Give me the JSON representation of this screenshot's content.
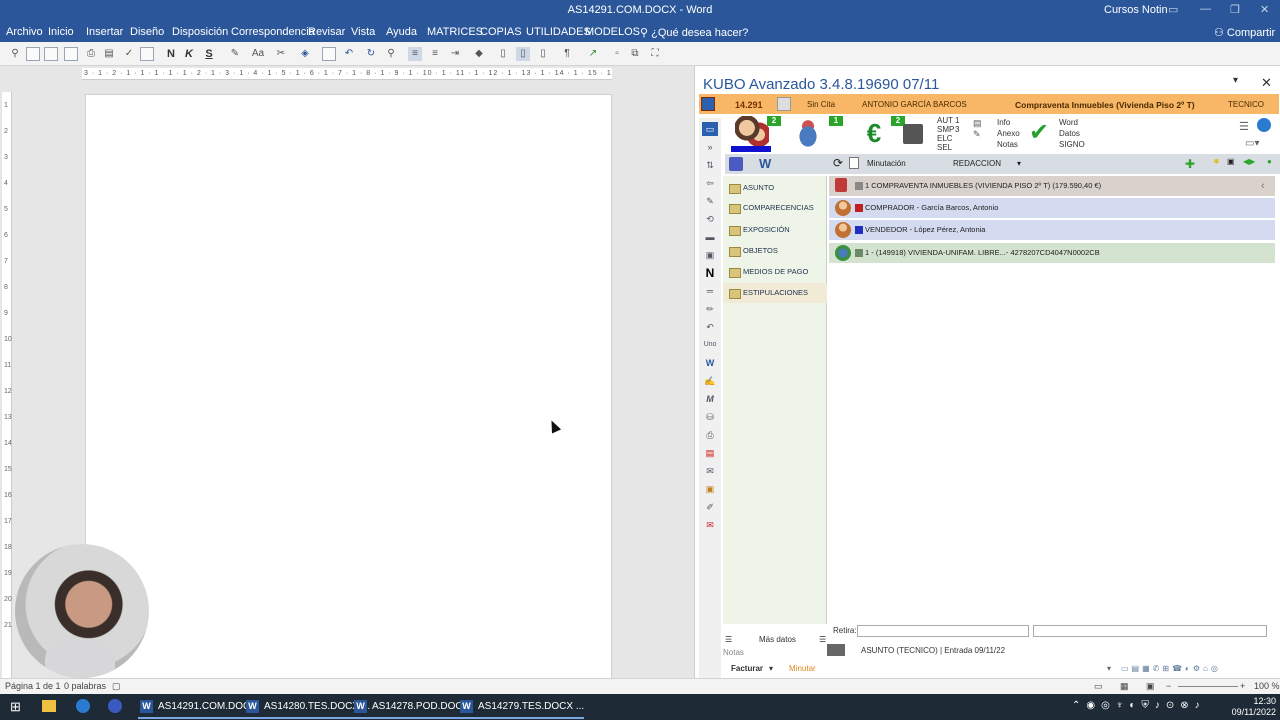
{
  "window": {
    "title": "AS14291.COM.DOCX - Word",
    "user": "Cursos Notin",
    "controls": [
      "▭",
      "—",
      "❐",
      "✕"
    ]
  },
  "menu": [
    "Archivo",
    "Inicio",
    "Insertar",
    "Diseño",
    "Disposición",
    "Correspondencia",
    "Revisar",
    "Vista",
    "Ayuda",
    "MATRICES",
    "COPIAS",
    "UTILIDADES",
    "MODELOS",
    "¿Qué desea hacer?"
  ],
  "share_label": "Compartir",
  "toolbar": {
    "bold": "N",
    "italic": "K",
    "underline": "S",
    "font_size": "Aa",
    "pilcrow": "¶"
  },
  "ruler": {
    "horizontal": "3 · 1 · 2 · 1 · 1 · 1 · 1 · 1 · 2 · 1 · 3 · 1 · 4 · 1 · 5 · 1 · 6 · 1 · 7 · 1 · 8 · 1 · 9 · 1 · 10 · 1 · 11 · 1 · 12 · 1 · 13 · 1 · 14 · 1 · 15 · 1 · 16",
    "vertical_ticks": [
      "1",
      "2",
      "3",
      "4",
      "5",
      "6",
      "7",
      "8",
      "9",
      "10",
      "11",
      "12",
      "13",
      "14",
      "15",
      "16",
      "17",
      "18",
      "19",
      "20",
      "21"
    ]
  },
  "status": {
    "page": "Página 1 de 1",
    "words": "0 palabras",
    "zoom": "100 %"
  },
  "taskbar": {
    "items": [
      "AS14291.COM.DOC...",
      "AS14280.TES.DOCX ...",
      "AS14278.POD.DOC...",
      "AS14279.TES.DOCX ..."
    ],
    "time": "12:30",
    "date": "09/11/2022"
  },
  "kubo": {
    "title": "KUBO Avanzado 3.4.8.19690   07/11",
    "bar": {
      "number": "14.291",
      "cita": "Sin Cita",
      "person": "ANTONIO GARCÍA BARCOS",
      "subject": "Compraventa Inmuebles (Vivienda Piso 2º T)",
      "role": "TECNICO"
    },
    "badges": [
      "2",
      "1",
      "2"
    ],
    "codes": [
      "AUT",
      "SMP",
      "ELC",
      "SEL"
    ],
    "code_counts": [
      "1",
      "3"
    ],
    "info_links": [
      "Info",
      "Anexo",
      "Notas"
    ],
    "word_links": [
      "Word",
      "Datos",
      "SIGNO"
    ],
    "second_row": {
      "minutacion": "Minutación",
      "redaccion": "REDACCION"
    },
    "nav": [
      "ASUNTO",
      "COMPARECENCIAS",
      "EXPOSICIÓN",
      "OBJETOS",
      "MEDIOS DE PAGO",
      "ESTIPULACIONES"
    ],
    "rows": [
      "1 COMPRAVENTA INMUEBLES (VIVIENDA PISO 2º T) (179.590,40 €)",
      "COMPRADOR - García Barcos, Antonio",
      "VENDEDOR - López Pérez, Antonia",
      "1 - (149918) VIVIENDA-UNIFAM. LIBRE...- 4278207CD4047N0002CB"
    ],
    "bottom": {
      "retira": "Retira:",
      "mas_datos": "Más datos",
      "notas": "Notas",
      "asunto_status": "ASUNTO (TECNICO)  |  Entrada 09/11/22",
      "facturar": "Facturar",
      "minutar": "Minutar"
    }
  },
  "colors": {
    "word_blue": "#2b579a",
    "kubo_orange": "#f8b766",
    "badge_green": "#2aa52a"
  }
}
